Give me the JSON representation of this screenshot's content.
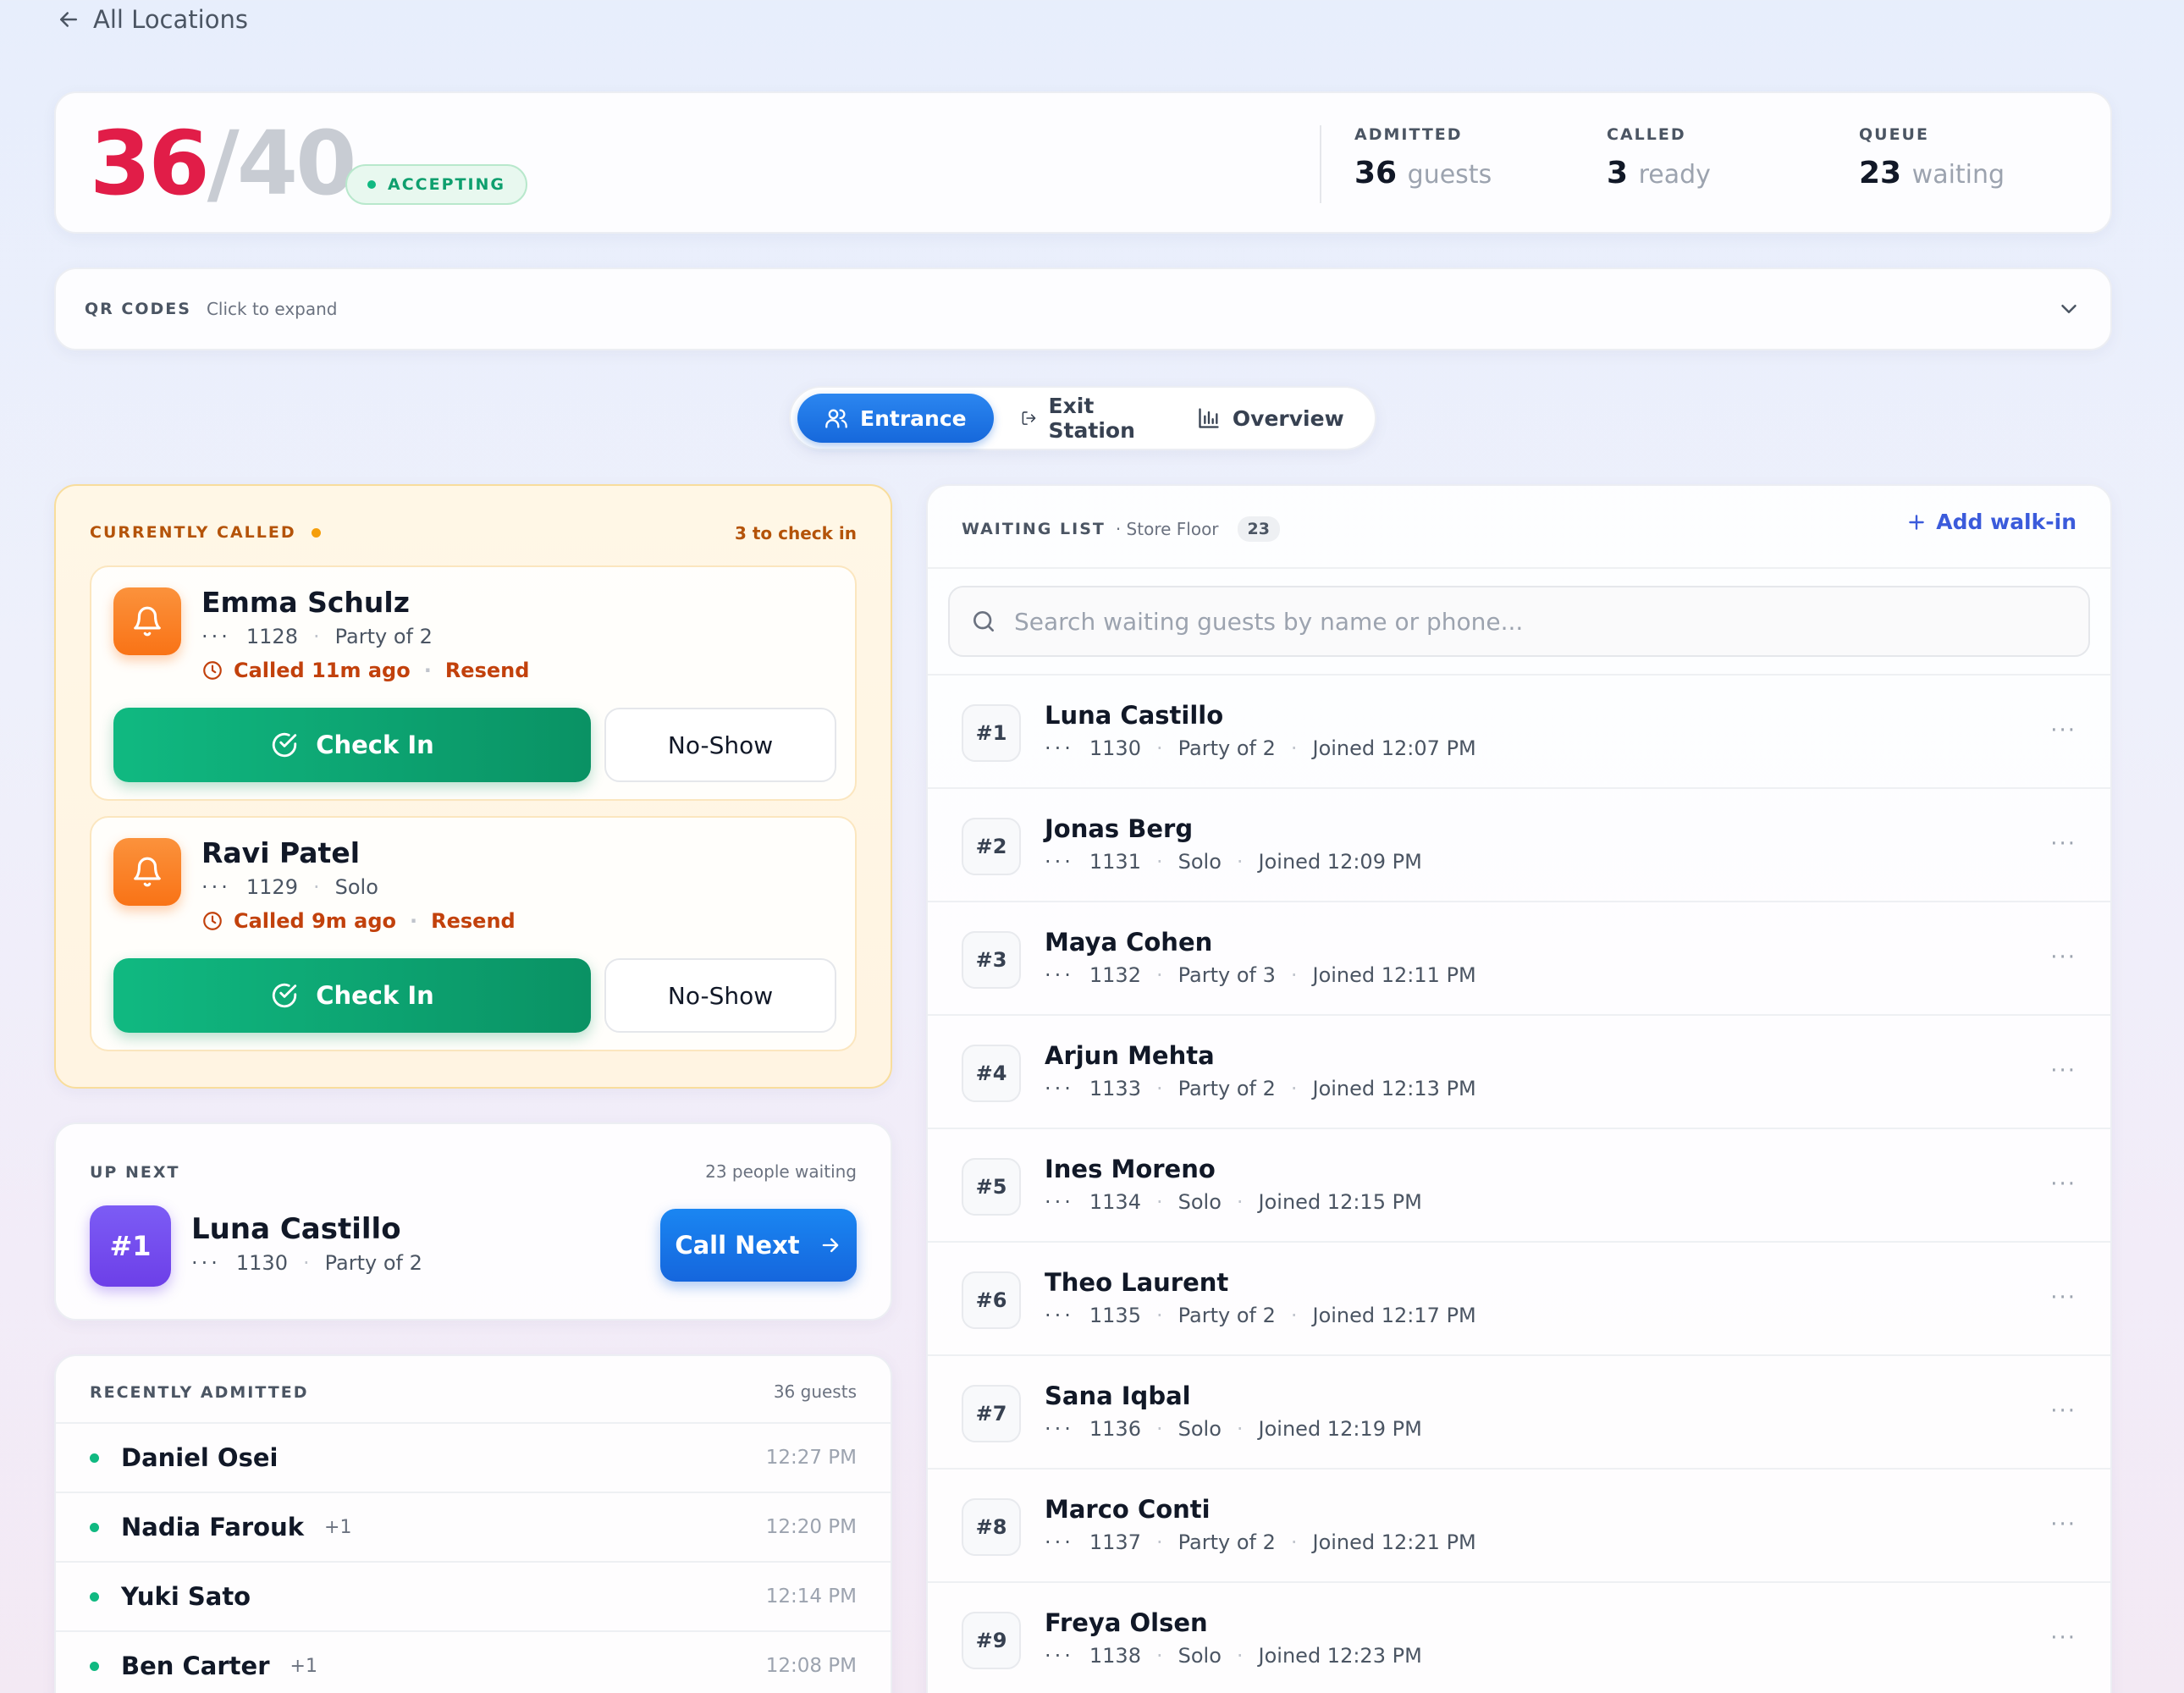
{
  "nav": {
    "back_label": "All Locations"
  },
  "capacity": {
    "current": "36",
    "separator": "/",
    "total": "40",
    "status": "ACCEPTING"
  },
  "stats": [
    {
      "label": "ADMITTED",
      "value": "36",
      "unit": "guests"
    },
    {
      "label": "CALLED",
      "value": "3",
      "unit": "ready"
    },
    {
      "label": "QUEUE",
      "value": "23",
      "unit": "waiting"
    }
  ],
  "qr": {
    "title": "QR CODES",
    "hint": "Click to expand"
  },
  "tabs": [
    {
      "label": "Entrance",
      "icon": "users-icon",
      "active": true
    },
    {
      "label": "Exit Station",
      "icon": "exit-icon",
      "active": false
    },
    {
      "label": "Overview",
      "icon": "bar-chart-icon",
      "active": false
    }
  ],
  "called": {
    "title": "CURRENTLY CALLED",
    "note": "3 to check in",
    "guests": [
      {
        "name": "Emma Schulz",
        "dots": "···",
        "id": "1128",
        "party": "Party of 2",
        "called": "Called 11m ago",
        "resend": "Resend",
        "check_in": "Check In",
        "no_show": "No-Show"
      },
      {
        "name": "Ravi Patel",
        "dots": "···",
        "id": "1129",
        "party": "Solo",
        "called": "Called 9m ago",
        "resend": "Resend",
        "check_in": "Check In",
        "no_show": "No-Show"
      }
    ]
  },
  "up_next": {
    "title": "UP NEXT",
    "note": "23 people waiting",
    "badge": "#1",
    "name": "Luna Castillo",
    "dots": "···",
    "id": "1130",
    "party": "Party of 2",
    "button": "Call Next"
  },
  "recent": {
    "title": "RECENTLY ADMITTED",
    "note": "36 guests",
    "rows": [
      {
        "name": "Daniel Osei",
        "plus": "",
        "time": "12:27 PM"
      },
      {
        "name": "Nadia Farouk",
        "plus": "+1",
        "time": "12:20 PM"
      },
      {
        "name": "Yuki Sato",
        "plus": "",
        "time": "12:14 PM"
      },
      {
        "name": "Ben Carter",
        "plus": "+1",
        "time": "12:08 PM"
      }
    ]
  },
  "waiting": {
    "title": "WAITING LIST",
    "location": "· Store Floor",
    "count": "23",
    "add_label": "Add walk-in",
    "search_placeholder": "Search waiting guests by name or phone...",
    "rows": [
      {
        "num": "#1",
        "name": "Luna Castillo",
        "dots": "···",
        "id": "1130",
        "party": "Party of 2",
        "joined": "Joined 12:07 PM"
      },
      {
        "num": "#2",
        "name": "Jonas Berg",
        "dots": "···",
        "id": "1131",
        "party": "Solo",
        "joined": "Joined 12:09 PM"
      },
      {
        "num": "#3",
        "name": "Maya Cohen",
        "dots": "···",
        "id": "1132",
        "party": "Party of 3",
        "joined": "Joined 12:11 PM"
      },
      {
        "num": "#4",
        "name": "Arjun Mehta",
        "dots": "···",
        "id": "1133",
        "party": "Party of 2",
        "joined": "Joined 12:13 PM"
      },
      {
        "num": "#5",
        "name": "Ines Moreno",
        "dots": "···",
        "id": "1134",
        "party": "Solo",
        "joined": "Joined 12:15 PM"
      },
      {
        "num": "#6",
        "name": "Theo Laurent",
        "dots": "···",
        "id": "1135",
        "party": "Party of 2",
        "joined": "Joined 12:17 PM"
      },
      {
        "num": "#7",
        "name": "Sana Iqbal",
        "dots": "···",
        "id": "1136",
        "party": "Solo",
        "joined": "Joined 12:19 PM"
      },
      {
        "num": "#8",
        "name": "Marco Conti",
        "dots": "···",
        "id": "1137",
        "party": "Party of 2",
        "joined": "Joined 12:21 PM"
      },
      {
        "num": "#9",
        "name": "Freya Olsen",
        "dots": "···",
        "id": "1138",
        "party": "Solo",
        "joined": "Joined 12:23 PM"
      }
    ],
    "more": "···"
  },
  "colors": {
    "brand_blue": "#1668db",
    "accept_green": "#10b981",
    "called_orange": "#f97316",
    "capacity_red": "#e11d48",
    "badge_purple": "#6d3fe8"
  }
}
